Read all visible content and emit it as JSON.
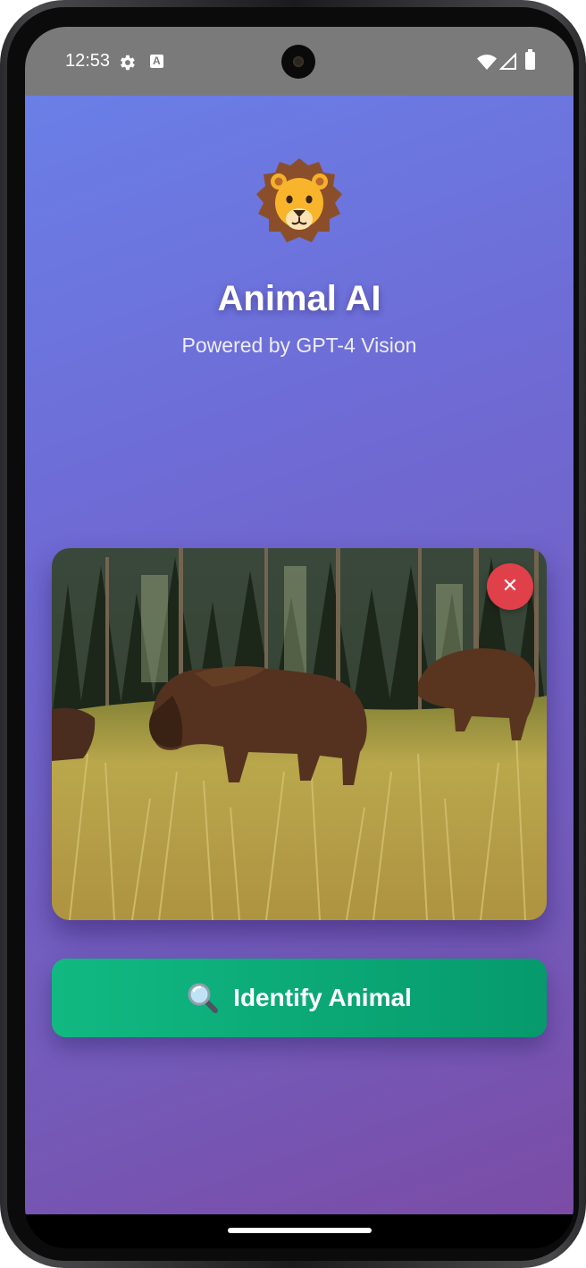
{
  "status_bar": {
    "time": "12:53",
    "icons": [
      "gear-icon",
      "a-notification-icon",
      "wifi-icon",
      "cell-signal-icon",
      "battery-icon"
    ]
  },
  "header": {
    "logo_icon": "lion-icon",
    "title": "Animal AI",
    "subtitle": "Powered by GPT-4 Vision"
  },
  "photo": {
    "description_icon": "bison-photo",
    "remove_label": "✕"
  },
  "identify_button": {
    "icon": "magnifier-icon",
    "label": "Identify Animal"
  },
  "colors": {
    "gradient_start": "#6a7fe7",
    "gradient_end": "#7a4ca6",
    "button_green": "#10b981",
    "remove_red": "#e0404a"
  }
}
